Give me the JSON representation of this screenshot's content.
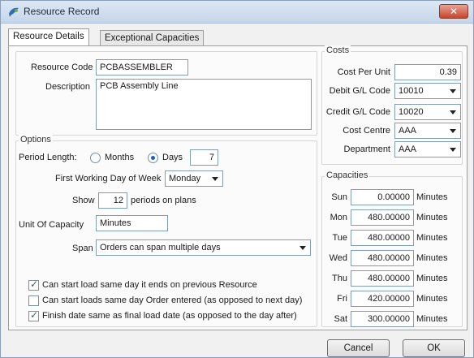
{
  "window": {
    "title": "Resource Record",
    "close_glyph": "✕"
  },
  "tabs": [
    {
      "label": "Resource Details"
    },
    {
      "label": "Exceptional Capacities"
    }
  ],
  "details": {
    "resource_code_label": "Resource Code",
    "resource_code_value": "PCBASSEMBLER",
    "description_label": "Description",
    "description_value": "PCB Assembly Line"
  },
  "options": {
    "title": "Options",
    "period_length_label": "Period Length:",
    "months_label": "Months",
    "days_label": "Days",
    "days_value": "7",
    "first_working_day_label": "First Working Day of Week",
    "first_working_day_value": "Monday",
    "show_label": "Show",
    "show_value": "12",
    "periods_label": "periods on plans",
    "unit_label": "Unit Of Capacity",
    "unit_value": "Minutes",
    "span_label": "Span",
    "span_value": "Orders can span multiple days",
    "checkboxes": [
      {
        "label": "Can start load same day it ends on previous Resource",
        "checked": true
      },
      {
        "label": "Can start loads same day Order entered (as opposed to next day)",
        "checked": false
      },
      {
        "label": "Finish date same as final load date (as opposed to the day after)",
        "checked": true
      }
    ]
  },
  "costs": {
    "title": "Costs",
    "cost_per_unit_label": "Cost Per Unit",
    "cost_per_unit_value": "0.39",
    "debit_label": "Debit G/L Code",
    "debit_value": "10010",
    "credit_label": "Credit G/L Code",
    "credit_value": "10020",
    "cost_centre_label": "Cost Centre",
    "cost_centre_value": "AAA",
    "department_label": "Department",
    "department_value": "AAA"
  },
  "capacities": {
    "title": "Capacities",
    "unit": "Minutes",
    "days": [
      {
        "day": "Sun",
        "value": "0.00000"
      },
      {
        "day": "Mon",
        "value": "480.00000"
      },
      {
        "day": "Tue",
        "value": "480.00000"
      },
      {
        "day": "Wed",
        "value": "480.00000"
      },
      {
        "day": "Thu",
        "value": "480.00000"
      },
      {
        "day": "Fri",
        "value": "420.00000"
      },
      {
        "day": "Sat",
        "value": "300.00000"
      }
    ]
  },
  "buttons": {
    "cancel": "Cancel",
    "ok": "OK"
  }
}
